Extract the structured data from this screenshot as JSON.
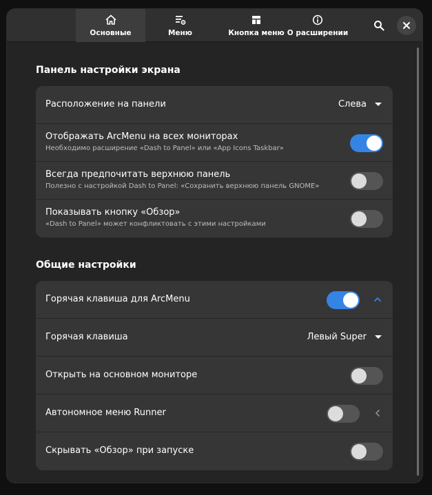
{
  "header": {
    "tabs": [
      {
        "label": "Основные",
        "icon": "home-icon",
        "active": true
      },
      {
        "label": "Меню",
        "icon": "menu-settings-icon",
        "active": false
      },
      {
        "label": "Кнопка меню",
        "icon": "layout-icon",
        "active": false
      },
      {
        "label": "О расширении",
        "icon": "info-icon",
        "active": false
      }
    ],
    "search_icon": "search-icon",
    "close_icon": "close-icon"
  },
  "panel_section": {
    "title": "Панель настройки экрана",
    "rows": [
      {
        "title": "Расположение на панели",
        "value": "Слева"
      },
      {
        "title": "Отображать ArcMenu на всех мониторах",
        "subtitle": "Необходимо расширение «Dash to Panel» или «App Icons Taskbar»",
        "enabled": true
      },
      {
        "title": "Всегда предпочитать верхнюю панель",
        "subtitle": "Полезно с настройкой Dash to Panel: «Сохранить верхнюю панель GNOME»",
        "enabled": false
      },
      {
        "title": "Показывать кнопку «Обзор»",
        "subtitle": "«Dash to Panel» может конфликтовать с этими настройками",
        "enabled": false
      }
    ]
  },
  "general_section": {
    "title": "Общие настройки",
    "rows": [
      {
        "title": "Горячая клавиша для ArcMenu",
        "enabled": true,
        "expanded": true
      },
      {
        "title": "Горячая клавиша",
        "value": "Левый Super"
      },
      {
        "title": "Открыть на основном мониторе",
        "enabled": false
      },
      {
        "title": "Автономное меню Runner",
        "enabled": false,
        "expanded": false
      },
      {
        "title": "Скрывать «Обзор» при запуске",
        "enabled": false
      }
    ]
  },
  "colors": {
    "accent": "#3584e4",
    "window_bg": "#242424",
    "card_bg": "#363636",
    "header_bg": "#303030"
  }
}
